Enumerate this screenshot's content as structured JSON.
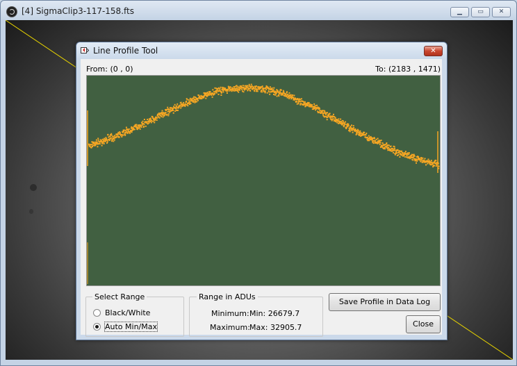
{
  "window": {
    "title": "[4] SigmaClip3-117-158.fts"
  },
  "dialog": {
    "title": "Line Profile Tool",
    "from_label": "From: (0 , 0)",
    "to_label": "To: (2183 , 1471)",
    "select_range": {
      "legend": "Select Range",
      "options": [
        "Black/White",
        "Auto Min/Max"
      ],
      "selected": "Auto Min/Max"
    },
    "range_adus": {
      "legend": "Range in ADUs",
      "minimum_label": "Minimum:",
      "minimum_value": "Min: 26679.7",
      "maximum_label": "Maximum:",
      "maximum_value": "Max: 32905.7"
    },
    "buttons": {
      "save": "Save Profile in Data Log",
      "close": "Close"
    }
  },
  "colors": {
    "plot_background": "#416041",
    "profile_points": "#f5a623"
  }
}
